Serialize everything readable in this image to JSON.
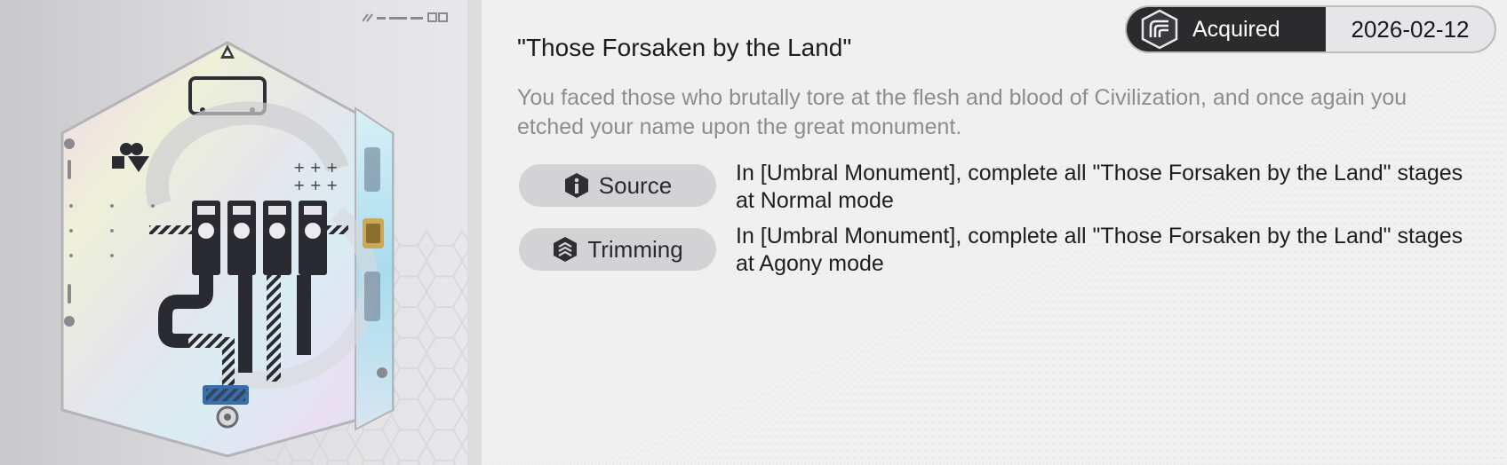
{
  "medal": {
    "name": "\"Those Forsaken by the Land\"",
    "description": "You faced those who brutally tore at the flesh and blood of Civilization, and once again you etched your name upon the great monument.",
    "emblem_icon": "hexagon-circuit-emblem"
  },
  "status": {
    "label": "Acquired",
    "date": "2026-02-12",
    "icon": "layers-logo-icon"
  },
  "requirements": [
    {
      "label": "Source",
      "icon": "info-icon",
      "text": "In [Umbral Monument], complete all \"Those Forsaken by the Land\" stages at Normal mode"
    },
    {
      "label": "Trimming",
      "icon": "trimming-icon",
      "text": "In [Umbral Monument], complete all \"Those Forsaken by the Land\" stages at Agony mode"
    }
  ],
  "colors": {
    "badge_dark": "#2b2b2e",
    "pill_bg": "#d3d3d5",
    "description": "#8d8d90"
  }
}
